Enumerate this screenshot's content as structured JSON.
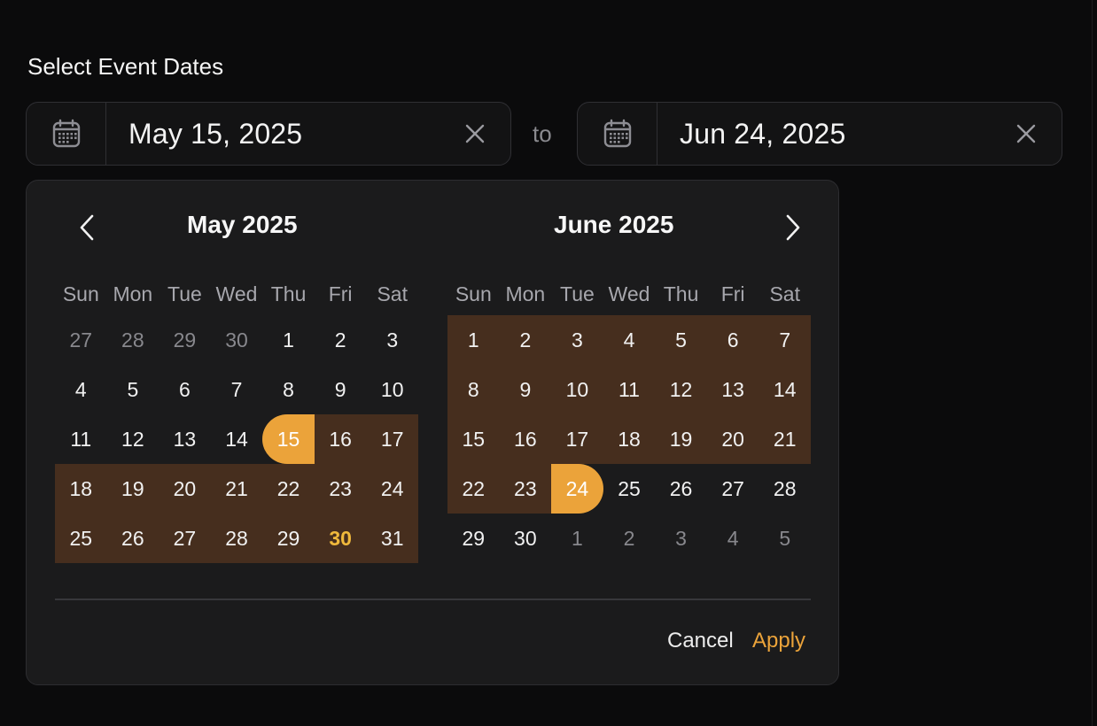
{
  "label": "Select Event Dates",
  "start_field": {
    "value": "May 15, 2025",
    "icon": "calendar-icon",
    "clear_icon": "close-icon"
  },
  "separator": "to",
  "end_field": {
    "value": "Jun 24, 2025",
    "icon": "calendar-icon",
    "clear_icon": "close-icon"
  },
  "weekdays": [
    "Sun",
    "Mon",
    "Tue",
    "Wed",
    "Thu",
    "Fri",
    "Sat"
  ],
  "months": [
    {
      "title": "May 2025",
      "weeks": [
        [
          {
            "d": "27",
            "state": "muted"
          },
          {
            "d": "28",
            "state": "muted"
          },
          {
            "d": "29",
            "state": "muted"
          },
          {
            "d": "30",
            "state": "muted"
          },
          {
            "d": "1"
          },
          {
            "d": "2"
          },
          {
            "d": "3"
          }
        ],
        [
          {
            "d": "4"
          },
          {
            "d": "5"
          },
          {
            "d": "6"
          },
          {
            "d": "7"
          },
          {
            "d": "8"
          },
          {
            "d": "9"
          },
          {
            "d": "10"
          }
        ],
        [
          {
            "d": "11"
          },
          {
            "d": "12"
          },
          {
            "d": "13"
          },
          {
            "d": "14"
          },
          {
            "d": "15",
            "state": "start"
          },
          {
            "d": "16",
            "state": "inrange"
          },
          {
            "d": "17",
            "state": "inrange"
          }
        ],
        [
          {
            "d": "18",
            "state": "inrange"
          },
          {
            "d": "19",
            "state": "inrange"
          },
          {
            "d": "20",
            "state": "inrange"
          },
          {
            "d": "21",
            "state": "inrange"
          },
          {
            "d": "22",
            "state": "inrange"
          },
          {
            "d": "23",
            "state": "inrange"
          },
          {
            "d": "24",
            "state": "inrange"
          }
        ],
        [
          {
            "d": "25",
            "state": "inrange"
          },
          {
            "d": "26",
            "state": "inrange"
          },
          {
            "d": "27",
            "state": "inrange"
          },
          {
            "d": "28",
            "state": "inrange"
          },
          {
            "d": "29",
            "state": "inrange"
          },
          {
            "d": "30",
            "state": "inrange today"
          },
          {
            "d": "31",
            "state": "inrange"
          }
        ]
      ]
    },
    {
      "title": "June 2025",
      "weeks": [
        [
          {
            "d": "1",
            "state": "inrange"
          },
          {
            "d": "2",
            "state": "inrange"
          },
          {
            "d": "3",
            "state": "inrange"
          },
          {
            "d": "4",
            "state": "inrange"
          },
          {
            "d": "5",
            "state": "inrange"
          },
          {
            "d": "6",
            "state": "inrange"
          },
          {
            "d": "7",
            "state": "inrange"
          }
        ],
        [
          {
            "d": "8",
            "state": "inrange"
          },
          {
            "d": "9",
            "state": "inrange"
          },
          {
            "d": "10",
            "state": "inrange"
          },
          {
            "d": "11",
            "state": "inrange"
          },
          {
            "d": "12",
            "state": "inrange"
          },
          {
            "d": "13",
            "state": "inrange"
          },
          {
            "d": "14",
            "state": "inrange"
          }
        ],
        [
          {
            "d": "15",
            "state": "inrange"
          },
          {
            "d": "16",
            "state": "inrange"
          },
          {
            "d": "17",
            "state": "inrange"
          },
          {
            "d": "18",
            "state": "inrange"
          },
          {
            "d": "19",
            "state": "inrange"
          },
          {
            "d": "20",
            "state": "inrange"
          },
          {
            "d": "21",
            "state": "inrange"
          }
        ],
        [
          {
            "d": "22",
            "state": "inrange"
          },
          {
            "d": "23",
            "state": "inrange"
          },
          {
            "d": "24",
            "state": "end"
          },
          {
            "d": "25"
          },
          {
            "d": "26"
          },
          {
            "d": "27"
          },
          {
            "d": "28"
          }
        ],
        [
          {
            "d": "29"
          },
          {
            "d": "30"
          },
          {
            "d": "1",
            "state": "muted"
          },
          {
            "d": "2",
            "state": "muted"
          },
          {
            "d": "3",
            "state": "muted"
          },
          {
            "d": "4",
            "state": "muted"
          },
          {
            "d": "5",
            "state": "muted"
          }
        ]
      ]
    }
  ],
  "nav": {
    "prev_icon": "chevron-left-icon",
    "next_icon": "chevron-right-icon"
  },
  "actions": {
    "cancel": "Cancel",
    "apply": "Apply"
  },
  "colors": {
    "accent": "#eba33a",
    "range": "#462e1e",
    "today": "#f0b93c",
    "background": "#0b0b0c",
    "surface": "#1b1b1c"
  }
}
